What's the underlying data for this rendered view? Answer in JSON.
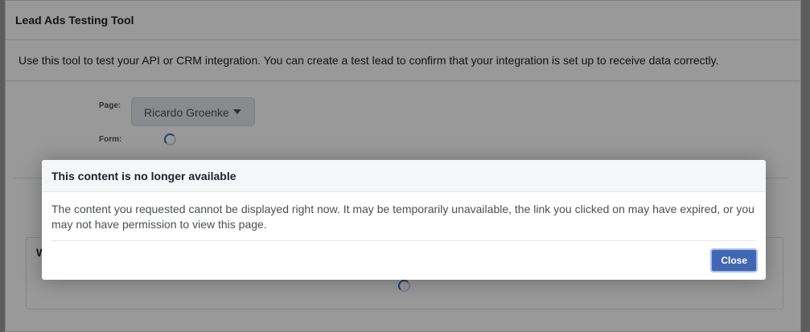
{
  "tool": {
    "title": "Lead Ads Testing Tool",
    "description": "Use this tool to test your API or CRM integration. You can create a test lead to confirm that your integration is set up to receive data correctly.",
    "page_label": "Page:",
    "page_value": "Ricardo Groenke",
    "form_label": "Form:",
    "helper_text": "",
    "sub_box_title": "W"
  },
  "dialog": {
    "title": "This content is no longer available",
    "body": "The content you requested cannot be displayed right now. It may be temporarily unavailable, the link you clicked on may have expired, or you may not have permission to view this page.",
    "close_label": "Close"
  },
  "colors": {
    "primary_button": "#4267b2",
    "overlay": "rgba(0,0,0,0.4)"
  },
  "icons": [
    "chevron-down-icon",
    "loading-spinner-icon"
  ]
}
